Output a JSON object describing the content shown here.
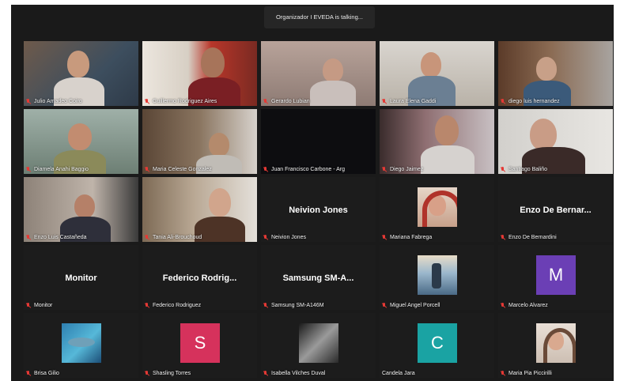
{
  "meeting": {
    "talking_banner": "Organizador I EVEDA is talking..."
  },
  "colors": {
    "stage_bg": "#1a1a1a",
    "tile_bg": "#1c1c1c",
    "mic_muted": "#e53935",
    "avatar_s": "#d6325c",
    "avatar_c": "#1aa3a3",
    "avatar_m": "#6b3fb5"
  },
  "participants": [
    {
      "name": "Julio Amadeo Coiro"
    },
    {
      "name": "Guillermo Rodriguez Aires"
    },
    {
      "name": "Gerardo Lubian"
    },
    {
      "name": "Laura Elena Gaddi"
    },
    {
      "name": "diego luis hernandez"
    },
    {
      "name": "Diamela Anahi Baggio"
    },
    {
      "name": "Maria Celeste Gonzalez"
    },
    {
      "name": "Juan Francisco Carbone - Arg"
    },
    {
      "name": "Diego Jaimez"
    },
    {
      "name": "Santiago Baliño"
    },
    {
      "name": "Enzo Luis Castañeda"
    },
    {
      "name": "Tania Ali-Brouchoud"
    },
    {
      "name": "Neivion Jones",
      "display_name": "Neivion Jones"
    },
    {
      "name": "Mariana Fabrega"
    },
    {
      "name": "Enzo De Bernardini",
      "display_name": "Enzo De Bernar..."
    },
    {
      "name": "Monitor",
      "display_name": "Monitor"
    },
    {
      "name": "Federico Rodriguez",
      "display_name": "Federico Rodrig..."
    },
    {
      "name": "Samsung SM-A146M",
      "display_name": "Samsung SM-A..."
    },
    {
      "name": "Miguel Angel Porcell"
    },
    {
      "name": "Marcelo Alvarez",
      "avatar_letter": "M"
    },
    {
      "name": "Brisa Gilio"
    },
    {
      "name": "Shasling Torres",
      "avatar_letter": "S"
    },
    {
      "name": "Isabella Vilches Duval"
    },
    {
      "name": "Candela Jara",
      "avatar_letter": "C"
    },
    {
      "name": "Maria Pia Piccirilli"
    }
  ]
}
